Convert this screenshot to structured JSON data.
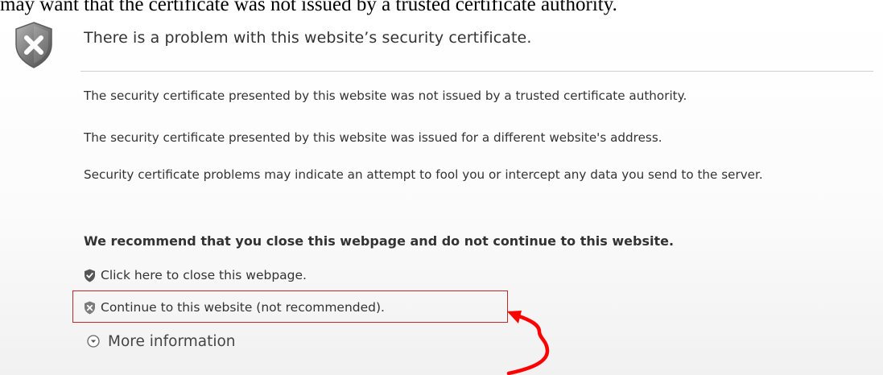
{
  "document_text": "may want that the certificate was not issued by a trusted certificate authority.",
  "warning": {
    "title": "There is a problem with this website’s security certificate.",
    "paragraph1": "The security certificate presented by this website was not issued by a trusted certificate authority.",
    "paragraph2": "The security certificate presented by this website was issued for a different website's address.",
    "paragraph3": "Security certificate problems may indicate an attempt to fool you or intercept any data you send to the server.",
    "recommendation": "We recommend that you close this webpage and do not continue to this website.",
    "close_link": "Click here to close this webpage.",
    "continue_link": "Continue to this website (not recommended).",
    "more_info": "More information"
  },
  "icons": {
    "title_icon": "shield-x-icon",
    "close_link_icon": "shield-check-icon",
    "continue_link_icon": "shield-x-icon",
    "more_info_icon": "chevron-down-circle-icon"
  },
  "colors": {
    "highlight": "#c0272d",
    "arrow": "#ff0000",
    "text": "#333333"
  }
}
